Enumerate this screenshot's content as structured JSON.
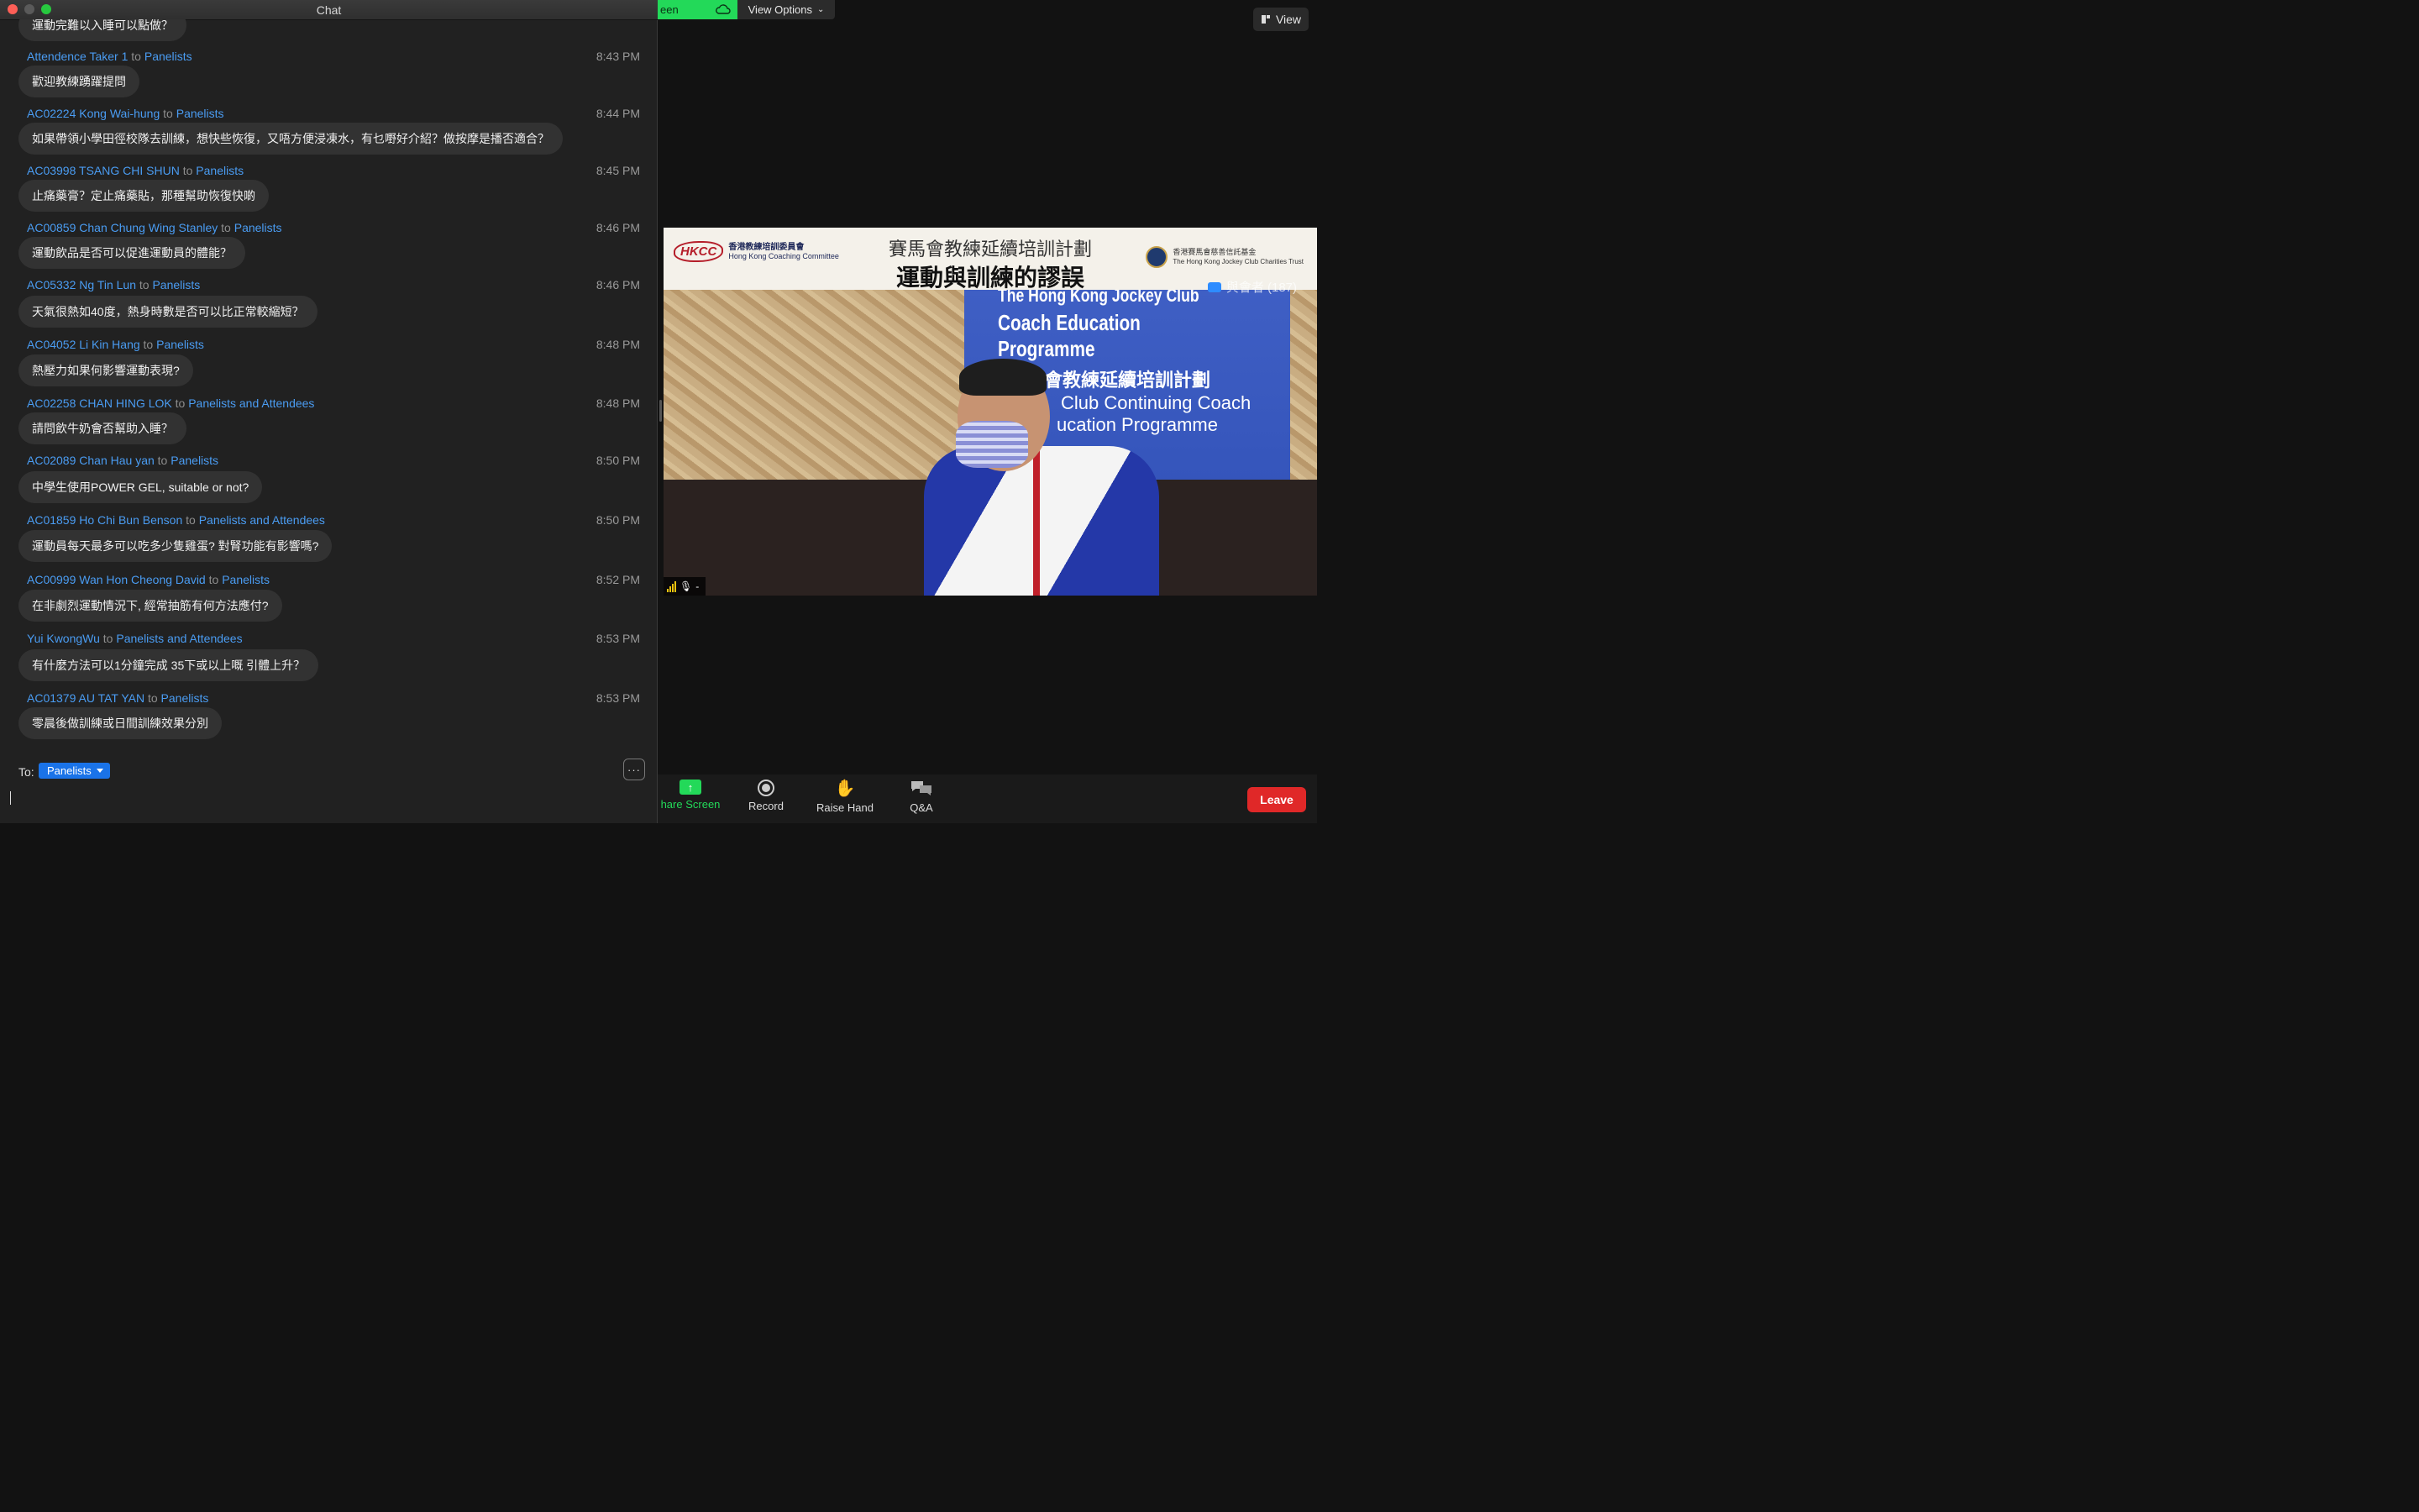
{
  "main": {
    "share_banner": "een",
    "view_options": "View Options",
    "view_button": "View",
    "video": {
      "header_title_1": "賽馬會教練延續培訓計劃",
      "header_title_2": "運動與訓練的謬誤",
      "hkcc_mark": "HKCC",
      "hkcc_name_zh": "香港教練培訓委員會",
      "hkcc_name_en": "Hong Kong Coaching Committee",
      "hkjc_name_zh": "香港賽馬會慈善信託基金",
      "hkjc_name_en": "The Hong Kong Jockey Club Charities Trust",
      "banner_line_1": "The Hong Kong Jockey Club",
      "banner_line_2": "Coach Education Programme",
      "banner_line_3": "會教練延續培訓計劃",
      "banner_line_4": "Club Continuing Coach",
      "banner_line_5": "ucation Programme",
      "participants": "與會者 (187)"
    },
    "toolbar": {
      "share": "hare Screen",
      "record": "Record",
      "raise_hand": "Raise Hand",
      "qa": "Q&A",
      "leave": "Leave"
    }
  },
  "chat": {
    "title": "Chat",
    "top_partial": "運動完難以入睡可以點做？",
    "to_word": "to",
    "messages": [
      {
        "sender": "Attendence Taker 1",
        "recipient": "Panelists",
        "time": "8:43 PM",
        "text": "歡迎教練踴躍提問"
      },
      {
        "sender": "AC02224 Kong Wai-hung",
        "recipient": "Panelists",
        "time": "8:44 PM",
        "text": "如果帶領小學田徑校隊去訓練，想快些恢復，又唔方便浸凍水，有乜嘢好介紹？做按摩是播否適合？"
      },
      {
        "sender": "AC03998 TSANG CHI SHUN",
        "recipient": "Panelists",
        "time": "8:45 PM",
        "text": "止痛藥膏？定止痛藥貼，那種幫助恢復快啲"
      },
      {
        "sender": "AC00859 Chan Chung Wing Stanley",
        "recipient": "Panelists",
        "time": "8:46 PM",
        "text": "運動飲品是否可以促進運動員的體能？"
      },
      {
        "sender": "AC05332 Ng Tin Lun",
        "recipient": "Panelists",
        "time": "8:46 PM",
        "text": "天氣很熱如40度，熱身時數是否可以比正常較縮短？"
      },
      {
        "sender": "AC04052 Li Kin Hang",
        "recipient": "Panelists",
        "time": "8:48 PM",
        "text": "熱壓力如果何影響運動表現?"
      },
      {
        "sender": "AC02258 CHAN HING LOK",
        "recipient": "Panelists and Attendees",
        "time": "8:48 PM",
        "text": "請問飲牛奶會否幫助入睡？"
      },
      {
        "sender": "AC02089 Chan Hau yan",
        "recipient": "Panelists",
        "time": "8:50 PM",
        "text": "中學生使用POWER GEL, suitable or not?"
      },
      {
        "sender": "AC01859 Ho Chi Bun Benson",
        "recipient": "Panelists and Attendees",
        "time": "8:50 PM",
        "text": "運動員每天最多可以吃多少隻雞蛋? 對腎功能有影響嗎?"
      },
      {
        "sender": "AC00999 Wan Hon Cheong David",
        "recipient": "Panelists",
        "time": "8:52 PM",
        "text": "在非劇烈運動情況下, 經常抽筋有何方法應付?"
      },
      {
        "sender": "Yui KwongWu",
        "recipient": "Panelists and Attendees",
        "time": "8:53 PM",
        "text": "有什麼方法可以1分鐘完成 35下或以上嘅 引體上升？"
      },
      {
        "sender": "AC01379 AU TAT YAN",
        "recipient": "Panelists",
        "time": "8:53 PM",
        "text": "零晨後做訓練或日間訓練效果分別"
      }
    ],
    "footer": {
      "to_label": "To:",
      "recipient": "Panelists",
      "more": "···"
    }
  }
}
